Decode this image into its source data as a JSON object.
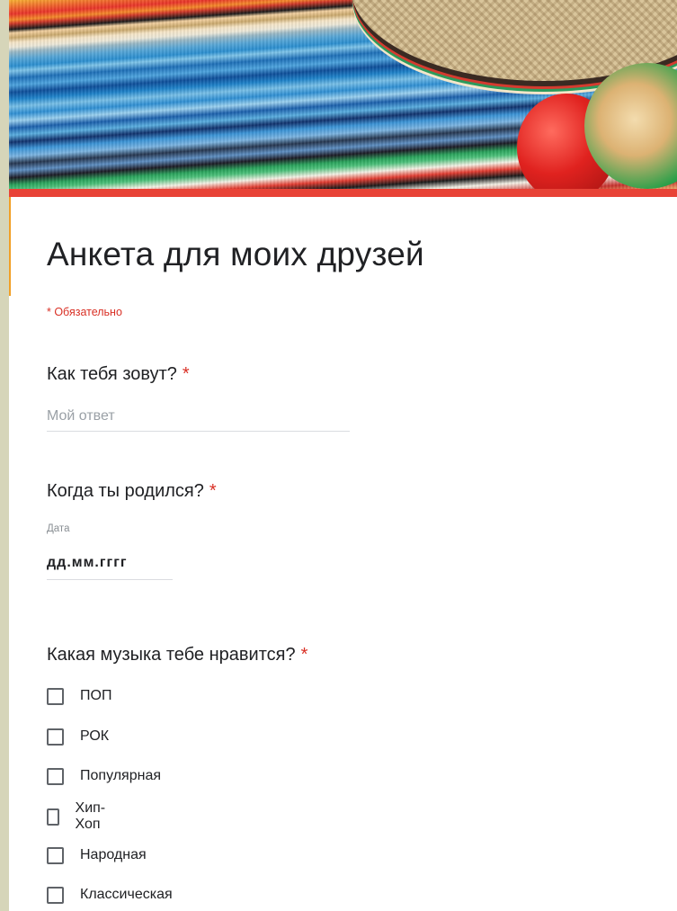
{
  "form": {
    "title": "Анкета для моих друзей",
    "required_note": "* Обязательно",
    "accent_color": "#e84337",
    "required_color": "#d93025"
  },
  "questions": [
    {
      "label": "Как тебя зовут?",
      "required_mark": "*",
      "placeholder": "Мой ответ",
      "value": ""
    },
    {
      "label": "Когда ты родился?",
      "required_mark": "*",
      "sub_label": "Дата",
      "value": "дд.мм.гггг"
    },
    {
      "label": "Какая музыка тебе нравится?",
      "required_mark": "*",
      "options": [
        {
          "label": "ПОП",
          "checked": false
        },
        {
          "label": "РОК",
          "checked": false
        },
        {
          "label": "Популярная",
          "checked": false
        },
        {
          "label": "Хип-Хоп",
          "checked": false
        },
        {
          "label": "Народная",
          "checked": false
        },
        {
          "label": "Классическая",
          "checked": false
        }
      ]
    }
  ]
}
